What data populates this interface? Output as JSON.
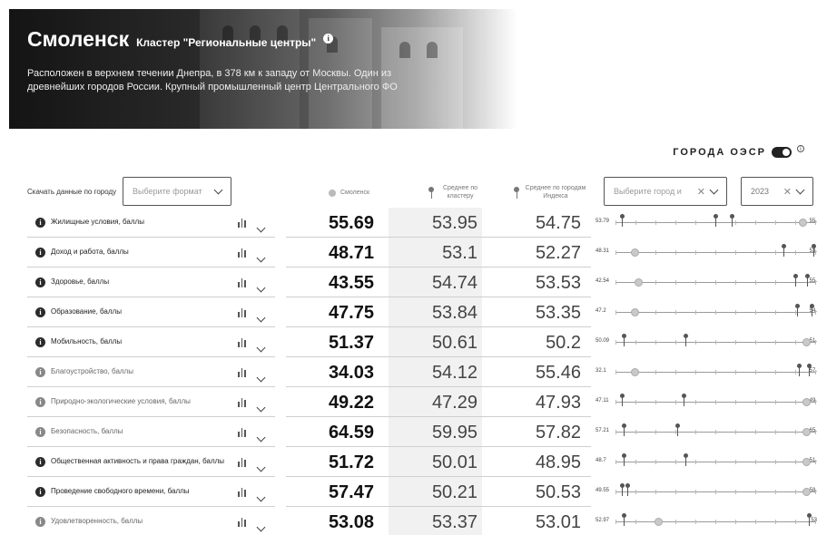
{
  "header": {
    "city": "Смоленск",
    "cluster": "Кластер \"Региональные центры\"",
    "description": "Расположен в верхнем течении Днепра, в 378 км к западу от Москвы. Один из древнейших городов России. Крупный промышленный центр Центрального ФО"
  },
  "toggle": {
    "label": "ГОРОДА ОЭСР",
    "state": "on"
  },
  "controls": {
    "download_label": "Скачать данные по городу",
    "format_placeholder": "Выберите формат",
    "city_placeholder": "Выберите город и",
    "year_value": "2023"
  },
  "columns": {
    "city": "Смоленск",
    "cluster": "Среднее по кластеру",
    "index": "Среднее по городам Индекса"
  },
  "rows": [
    {
      "label": "Жилищные условия, баллы",
      "active": true,
      "value": "55.69",
      "cluster": "53.95",
      "index": "54.75",
      "min_label": "53.79",
      "max_label": "55.",
      "marker_fracs": [
        0.5,
        0.03,
        0.58
      ],
      "ring_frac": 0.94
    },
    {
      "label": "Доход и работа, баллы",
      "active": true,
      "value": "48.71",
      "cluster": "53.1",
      "index": "52.27",
      "min_label": "48.31",
      "max_label": "53.",
      "marker_fracs": [
        0.84,
        0.99
      ],
      "ring_frac": 0.1
    },
    {
      "label": "Здоровье, баллы",
      "active": true,
      "value": "43.55",
      "cluster": "54.74",
      "index": "53.53",
      "min_label": "42.54",
      "max_label": "55.",
      "marker_fracs": [
        0.9,
        0.96
      ],
      "ring_frac": 0.12
    },
    {
      "label": "Образование, баллы",
      "active": true,
      "value": "47.75",
      "cluster": "53.84",
      "index": "53.35",
      "min_label": "47.2",
      "max_label": "54.",
      "marker_fracs": [
        0.91,
        0.98
      ],
      "ring_frac": 0.1
    },
    {
      "label": "Мобильность, баллы",
      "active": true,
      "value": "51.37",
      "cluster": "50.61",
      "index": "50.2",
      "min_label": "50.09",
      "max_label": "51.",
      "marker_fracs": [
        0.04,
        0.35
      ],
      "ring_frac": 0.96
    },
    {
      "label": "Благоустройство, баллы",
      "active": false,
      "value": "34.03",
      "cluster": "54.12",
      "index": "55.46",
      "min_label": "32.1",
      "max_label": "57.",
      "marker_fracs": [
        0.92,
        0.97
      ],
      "ring_frac": 0.1
    },
    {
      "label": "Природно-экологические условия, баллы",
      "active": false,
      "value": "49.22",
      "cluster": "47.29",
      "index": "47.93",
      "min_label": "47.11",
      "max_label": "49.",
      "marker_fracs": [
        0.03,
        0.34
      ],
      "ring_frac": 0.96
    },
    {
      "label": "Безопасность, баллы",
      "active": false,
      "value": "64.59",
      "cluster": "59.95",
      "index": "57.82",
      "min_label": "57.21",
      "max_label": "65.",
      "marker_fracs": [
        0.04,
        0.31
      ],
      "ring_frac": 0.96
    },
    {
      "label": "Общественная активность и права граждан, баллы",
      "active": true,
      "value": "51.72",
      "cluster": "50.01",
      "index": "48.95",
      "min_label": "48.7",
      "max_label": "51.",
      "marker_fracs": [
        0.04,
        0.35
      ],
      "ring_frac": 0.96
    },
    {
      "label": "Проведение свободного времени, баллы",
      "active": true,
      "value": "57.47",
      "cluster": "50.21",
      "index": "50.53",
      "min_label": "49.55",
      "max_label": "58.",
      "marker_fracs": [
        0.03,
        0.06
      ],
      "ring_frac": 0.96
    },
    {
      "label": "Удовлетворенность, баллы",
      "active": false,
      "value": "53.08",
      "cluster": "53.37",
      "index": "53.01",
      "min_label": "52.97",
      "max_label": "53",
      "marker_fracs": [
        0.04,
        0.97
      ],
      "ring_frac": 0.22
    }
  ]
}
